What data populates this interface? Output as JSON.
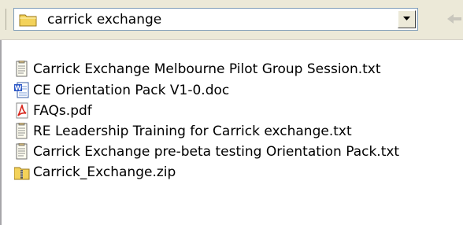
{
  "address_bar": {
    "folder_name": "carrick exchange",
    "folder_icon": "folder-icon",
    "dropdown_icon": "dropdown-arrow-icon",
    "back_icon": "back-arrow-icon"
  },
  "files": [
    {
      "name": "Carrick Exchange Melbourne Pilot Group Session.txt",
      "icon": "text-file-icon"
    },
    {
      "name": "CE Orientation Pack V1-0.doc",
      "icon": "word-document-icon"
    },
    {
      "name": "FAQs.pdf",
      "icon": "pdf-file-icon"
    },
    {
      "name": "RE Leadership Training for Carrick exchange.txt",
      "icon": "text-file-icon"
    },
    {
      "name": "Carrick Exchange pre-beta testing Orientation Pack.txt",
      "icon": "text-file-icon"
    },
    {
      "name": "Carrick_Exchange.zip",
      "icon": "zip-folder-icon"
    }
  ],
  "colors": {
    "toolbar_bg": "#ece9d8",
    "folder_yellow": "#f3d25a",
    "word_blue": "#2a56c6",
    "pdf_red": "#d8261c"
  }
}
